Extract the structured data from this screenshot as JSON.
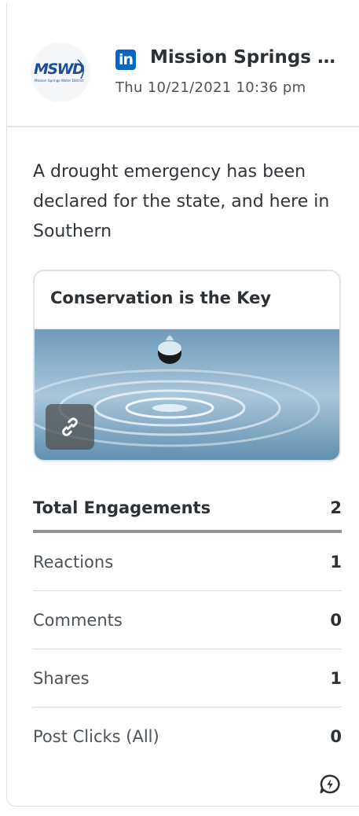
{
  "post": {
    "network_icon": "linkedin-icon",
    "network_letters": "in",
    "author": "Mission Springs Water District",
    "author_logo_text": "MSWD",
    "author_logo_subtext": "Mission Springs Water District",
    "timestamp": "Thu 10/21/2021 10:36 pm",
    "text": "A drought emergency has been declared for the state, and here in Southern",
    "link": {
      "title": "Conservation is the Key",
      "badge_icon": "link-icon"
    }
  },
  "stats": {
    "total_label": "Total Engagements",
    "total_value": "2",
    "rows": [
      {
        "label": "Reactions",
        "value": "1"
      },
      {
        "label": "Comments",
        "value": "0"
      },
      {
        "label": "Shares",
        "value": "1"
      },
      {
        "label": "Post Clicks (All)",
        "value": "0"
      }
    ]
  },
  "footer_icon": "lightning-chat-icon",
  "colors": {
    "accent": "#1f6fc5",
    "linkedin": "#0a66c2",
    "logo_blue": "#1b4f9c"
  }
}
